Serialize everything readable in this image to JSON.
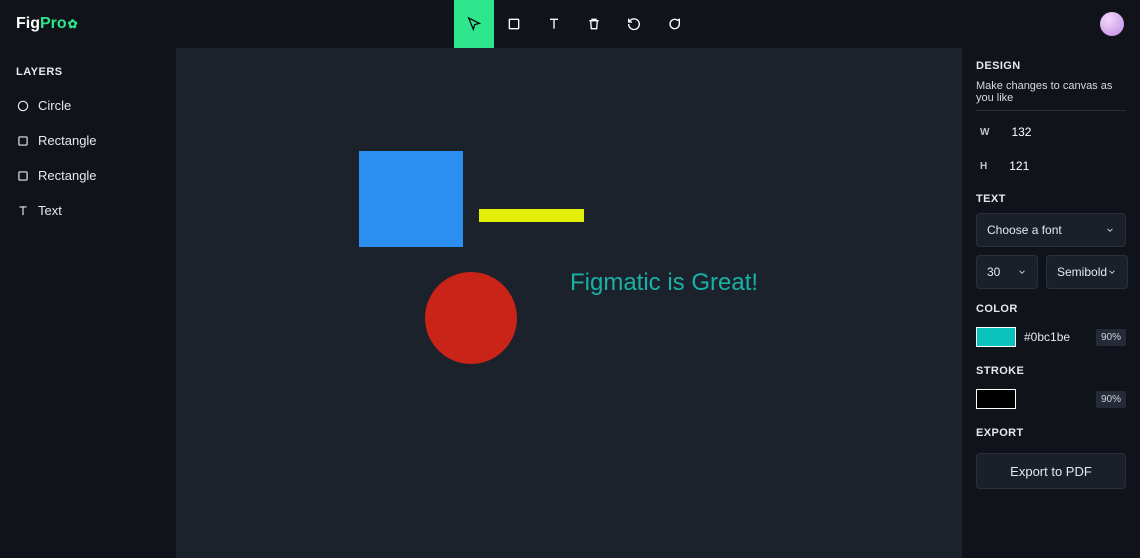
{
  "brand": {
    "part1": "Fig",
    "part2": "Pro"
  },
  "layers": {
    "heading": "LAYERS",
    "items": [
      {
        "label": "Circle",
        "icon": "circle"
      },
      {
        "label": "Rectangle",
        "icon": "rect"
      },
      {
        "label": "Rectangle",
        "icon": "rect"
      },
      {
        "label": "Text",
        "icon": "text"
      }
    ]
  },
  "canvas": {
    "text_content": "Figmatic is Great!"
  },
  "design": {
    "heading": "DESIGN",
    "subtitle": "Make changes to canvas as you like",
    "width_label": "W",
    "width_value": "132",
    "height_label": "H",
    "height_value": "121",
    "text_heading": "TEXT",
    "font_placeholder": "Choose a font",
    "font_size": "30",
    "font_weight": "Semibold",
    "color_heading": "COLOR",
    "color_hex": "#0bc1be",
    "color_opacity": "90%",
    "stroke_heading": "STROKE",
    "stroke_opacity": "90%",
    "export_heading": "EXPORT",
    "export_button": "Export to PDF"
  }
}
